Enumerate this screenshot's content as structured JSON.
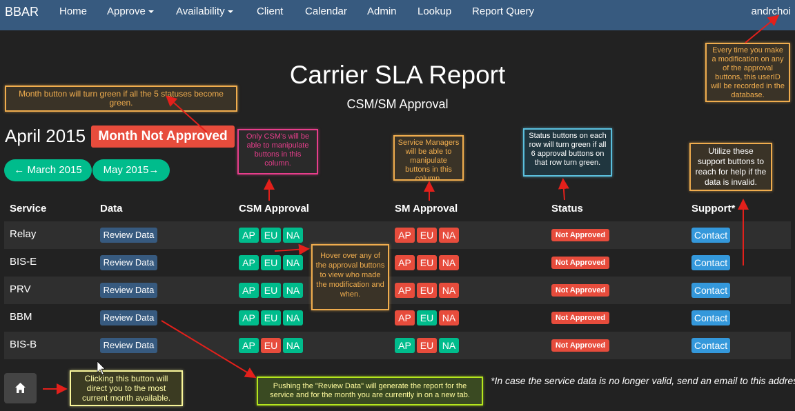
{
  "navbar": {
    "brand": "BBAR",
    "items": [
      "Home",
      "Approve",
      "Availability",
      "Client",
      "Calendar",
      "Admin",
      "Lookup",
      "Report Query"
    ],
    "user": "andrchoi"
  },
  "header": {
    "title": "Carrier SLA Report",
    "subtitle": "CSM/SM Approval"
  },
  "month": {
    "label": "April 2015",
    "status": "Month Not Approved",
    "prev": "← March 2015",
    "next": "May 2015→"
  },
  "table": {
    "headers": [
      "Service",
      "Data",
      "CSM Approval",
      "SM Approval",
      "Status",
      "Support*"
    ],
    "review_label": "Review Data",
    "contact_label": "Contact",
    "button_labels": [
      "AP",
      "EU",
      "NA"
    ],
    "rows": [
      {
        "service": "Relay",
        "status": "Not Approved",
        "csm": [
          "green",
          "green",
          "green"
        ],
        "sm": [
          "red",
          "red",
          "red"
        ]
      },
      {
        "service": "BIS-E",
        "status": "Not Approved",
        "csm": [
          "green",
          "green",
          "green"
        ],
        "sm": [
          "red",
          "red",
          "red"
        ]
      },
      {
        "service": "PRV",
        "status": "Not Approved",
        "csm": [
          "green",
          "green",
          "green"
        ],
        "sm": [
          "red",
          "red",
          "red"
        ]
      },
      {
        "service": "BBM",
        "status": "Not Approved",
        "csm": [
          "green",
          "green",
          "green"
        ],
        "sm": [
          "red",
          "green",
          "red"
        ]
      },
      {
        "service": "BIS-B",
        "status": "Not Approved",
        "csm": [
          "green",
          "red",
          "green"
        ],
        "sm": [
          "green",
          "red",
          "green"
        ]
      }
    ]
  },
  "footer_note": "*In case the service data is no longer valid, send an email to this address.",
  "annotations": {
    "userid": "Every time you make a modification on any of the approval buttons, this userID will be recorded in the database.",
    "month_button": "Month button will turn green if all the 5 statuses become green.",
    "csm": "Only CSM's will be able to manipulate buttons in this column.",
    "sm": "Service Managers will be able to manipulate buttons in this column.",
    "status": "Status buttons on each row will turn green if all 6 approval buttons on that row turn green.",
    "support": "Utilize these support buttons to reach for help if the data is invalid.",
    "hover": "Hover over any of the approval buttons to view who made the modification and when.",
    "review": "Pushing the \"Review Data\" will generate the report for the service and for the month you are currently in on a new tab.",
    "home": "Clicking this button will direct you to the most current month available."
  },
  "colors": {
    "navbar": "#375a7f",
    "green": "#00bc8c",
    "red": "#e74c3c",
    "blue": "#3498db",
    "background": "#222222"
  }
}
